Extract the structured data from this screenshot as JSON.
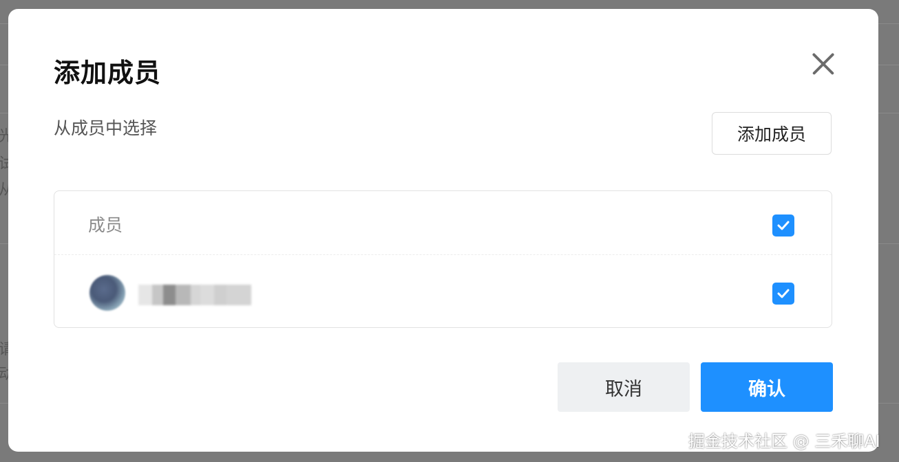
{
  "background_fragments": [
    "光",
    "试",
    "从",
    "请",
    "动"
  ],
  "dialog": {
    "title": "添加成员",
    "close_icon": "close-icon",
    "subtitle": "从成员中选择",
    "add_member_button": "添加成员",
    "table": {
      "header": {
        "label": "成员",
        "checked": true
      },
      "members": [
        {
          "avatar": "blurred-avatar",
          "name": "",
          "checked": true
        }
      ]
    },
    "cancel_button": "取消",
    "confirm_button": "确认"
  },
  "colors": {
    "accent": "#1e90ff",
    "overlay": "#7a7a7a",
    "cancel_bg": "#eef0f2"
  },
  "watermark": "掘金技术社区 @ 三禾聊AI"
}
